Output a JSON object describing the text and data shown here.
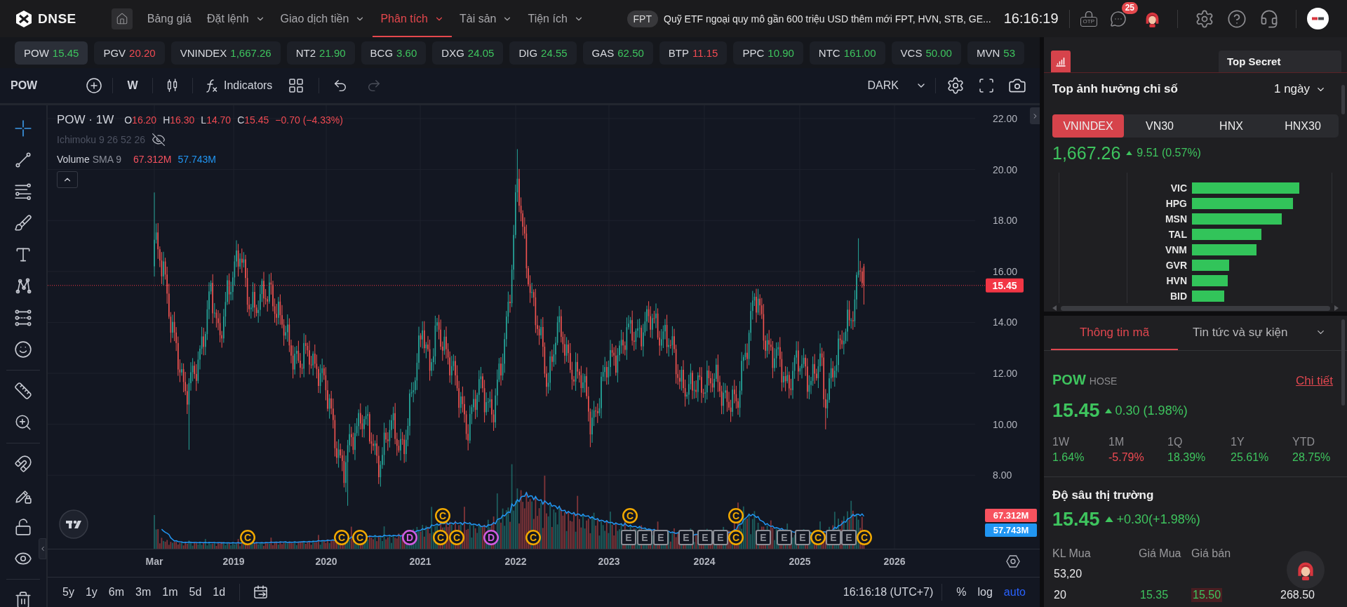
{
  "top_nav": {
    "logo": "DNSE",
    "menu": [
      {
        "label": "Bảng giá",
        "has_menu": false,
        "selected": false
      },
      {
        "label": "Đặt lệnh",
        "has_menu": true,
        "selected": false
      },
      {
        "label": "Giao dịch tiền",
        "has_menu": true,
        "selected": false
      },
      {
        "label": "Phân tích",
        "has_menu": true,
        "selected": true
      },
      {
        "label": "Tài sản",
        "has_menu": true,
        "selected": false
      },
      {
        "label": "Tiện ích",
        "has_menu": true,
        "selected": false
      }
    ],
    "news": {
      "tag": "FPT",
      "headline": "Quỹ ETF ngoại quy mô gần 600 triệu USD thêm mới FPT, HVN, STB, GE..."
    },
    "clock": "16:16:19",
    "otp_label": "OTP",
    "chat_badge": "25"
  },
  "watchlist": [
    {
      "symbol": "POW",
      "price": "15.45",
      "rising": true,
      "selected": true
    },
    {
      "symbol": "PGV",
      "price": "20.20",
      "rising": false,
      "selected": false
    },
    {
      "symbol": "VNINDEX",
      "price": "1,667.26",
      "rising": true,
      "selected": false
    },
    {
      "symbol": "NT2",
      "price": "21.90",
      "rising": true,
      "selected": false
    },
    {
      "symbol": "BCG",
      "price": "3.60",
      "rising": true,
      "selected": false
    },
    {
      "symbol": "DXG",
      "price": "24.05",
      "rising": true,
      "selected": false
    },
    {
      "symbol": "DIG",
      "price": "24.55",
      "rising": true,
      "selected": false
    },
    {
      "symbol": "GAS",
      "price": "62.50",
      "rising": true,
      "selected": false
    },
    {
      "symbol": "BTP",
      "price": "11.15",
      "rising": false,
      "selected": false
    },
    {
      "symbol": "PPC",
      "price": "10.90",
      "rising": true,
      "selected": false
    },
    {
      "symbol": "NTC",
      "price": "161.00",
      "rising": true,
      "selected": false
    },
    {
      "symbol": "VCS",
      "price": "50.00",
      "rising": true,
      "selected": false
    },
    {
      "symbol": "MVN",
      "price": "53",
      "rising": true,
      "selected": false
    }
  ],
  "chart_toolbar": {
    "symbol": "POW",
    "interval": "W",
    "indicators": "Indicators",
    "history": [
      {
        "kind": "undo",
        "disabled": false
      },
      {
        "kind": "redo",
        "disabled": true
      }
    ],
    "theme": "DARK"
  },
  "drawing_tools": [
    [
      {
        "kind": "crosshair",
        "selected": true
      },
      {
        "kind": "trend-line",
        "selected": false
      },
      {
        "kind": "fib",
        "selected": false
      },
      {
        "kind": "brush",
        "selected": false
      },
      {
        "kind": "text",
        "selected": false
      },
      {
        "kind": "pattern",
        "selected": false
      },
      {
        "kind": "projection",
        "selected": false
      },
      {
        "kind": "emoji",
        "selected": false
      }
    ],
    [
      {
        "kind": "ruler",
        "selected": false
      },
      {
        "kind": "zoom",
        "selected": false
      }
    ],
    [
      {
        "kind": "magnet",
        "selected": false
      },
      {
        "kind": "draw-lock",
        "selected": false
      },
      {
        "kind": "lock",
        "selected": false
      },
      {
        "kind": "eye",
        "selected": false
      }
    ],
    [
      {
        "kind": "trash",
        "selected": false
      }
    ]
  ],
  "chart": {
    "legend": {
      "title": "POW · 1W",
      "rising": false,
      "ohlc": [
        {
          "key": "O",
          "value": "16.20"
        },
        {
          "key": "H",
          "value": "16.30"
        },
        {
          "key": "L",
          "value": "14.70"
        },
        {
          "key": "C",
          "value": "15.45"
        }
      ],
      "change": "−0.70 (−4.33%)"
    },
    "ichimoku": {
      "label": "Ichimoku 9 26 52 26",
      "visible": false
    },
    "volume": {
      "label": "Volume",
      "params": "SMA 9",
      "values": [
        {
          "text": "67.312M",
          "color": "#f7525f"
        },
        {
          "text": "57.743M",
          "color": "#2196f3"
        }
      ]
    },
    "price_ticks": [
      "22.00",
      "20.00",
      "18.00",
      "16.00",
      "14.00",
      "12.00",
      "10.00",
      "8.00"
    ],
    "last_price": "15.45",
    "volume_badges": [
      {
        "text": "67.312M",
        "color": "#f7525f"
      },
      {
        "text": "57.743M",
        "color": "#2196f3"
      }
    ],
    "time_labels": [
      "Mar",
      "2019",
      "2020",
      "2021",
      "2022",
      "2023",
      "2024",
      "2025",
      "2026"
    ],
    "event_markers": {
      "upper": [
        {
          "label": "C",
          "kind": "circle",
          "color": "#f2a900"
        },
        {
          "label": "C",
          "kind": "circle",
          "color": "#f2a900"
        },
        {
          "label": "C",
          "kind": "circle",
          "color": "#f2a900"
        }
      ],
      "lower": [
        {
          "label": "C",
          "kind": "circle",
          "color": "#f2a900"
        },
        {
          "label": "C",
          "kind": "circle",
          "color": "#f2a900"
        },
        {
          "label": "C",
          "kind": "circle",
          "color": "#f2a900"
        },
        {
          "label": "D",
          "kind": "circle",
          "color": "#d05ce3"
        },
        {
          "label": "C",
          "kind": "circle",
          "color": "#f2a900"
        },
        {
          "label": "C",
          "kind": "circle",
          "color": "#f2a900"
        },
        {
          "label": "D",
          "kind": "circle",
          "color": "#d05ce3"
        },
        {
          "label": "C",
          "kind": "circle",
          "color": "#f2a900"
        },
        {
          "label": "E",
          "kind": "square",
          "color": "#8b8e96"
        },
        {
          "label": "E",
          "kind": "square",
          "color": "#8b8e96"
        },
        {
          "label": "E",
          "kind": "square",
          "color": "#8b8e96"
        },
        {
          "label": "E",
          "kind": "square",
          "color": "#8b8e96"
        },
        {
          "label": "E",
          "kind": "square",
          "color": "#8b8e96"
        },
        {
          "label": "E",
          "kind": "square",
          "color": "#8b8e96"
        },
        {
          "label": "C",
          "kind": "circle",
          "color": "#f2a900"
        },
        {
          "label": "E",
          "kind": "square",
          "color": "#8b8e96"
        },
        {
          "label": "E",
          "kind": "square",
          "color": "#8b8e96"
        },
        {
          "label": "E",
          "kind": "square",
          "color": "#8b8e96"
        },
        {
          "label": "C",
          "kind": "circle",
          "color": "#f2a900"
        },
        {
          "label": "E",
          "kind": "square",
          "color": "#8b8e96"
        },
        {
          "label": "E",
          "kind": "square",
          "color": "#8b8e96"
        },
        {
          "label": "C",
          "kind": "circle",
          "color": "#f2a900"
        }
      ]
    }
  },
  "range_bar": {
    "ranges": [
      {
        "label": "5y",
        "selected": false
      },
      {
        "label": "1y",
        "selected": false
      },
      {
        "label": "6m",
        "selected": false
      },
      {
        "label": "3m",
        "selected": false
      },
      {
        "label": "1m",
        "selected": false
      },
      {
        "label": "5d",
        "selected": false
      },
      {
        "label": "1d",
        "selected": false
      }
    ],
    "time": "16:16:18 (UTC+7)",
    "scales": [
      {
        "label": "%",
        "on": false
      },
      {
        "label": "log",
        "on": false
      },
      {
        "label": "auto",
        "on": true
      }
    ]
  },
  "right_panel": {
    "tooltip": "Top Secret",
    "influence": {
      "title": "Top ảnh hưởng chỉ số",
      "period": "1 ngày",
      "indices": [
        {
          "label": "VNINDEX",
          "selected": true
        },
        {
          "label": "VN30",
          "selected": false
        },
        {
          "label": "HNX",
          "selected": false
        },
        {
          "label": "HNX30",
          "selected": false
        }
      ],
      "value": "1,667.26",
      "change": "9.51 (0.57%)",
      "rising": true,
      "bars": [
        "VIC",
        "HPG",
        "MSN",
        "TAL",
        "VNM",
        "GVR",
        "HVN",
        "BID"
      ]
    },
    "info_tabs": [
      {
        "label": "Thông tin mã",
        "selected": true,
        "has_menu": false
      },
      {
        "label": "Tin tức và sự kiện",
        "selected": false,
        "has_menu": true
      }
    ],
    "stock": {
      "symbol": "POW",
      "exchange": "HOSE",
      "detail_link": "Chi tiết",
      "price": "15.45",
      "change": "0.30 (1.98%)",
      "rising": true,
      "periods": [
        {
          "label": "1W",
          "value": "1.64%",
          "rising": true
        },
        {
          "label": "1M",
          "value": "-5.79%",
          "rising": false
        },
        {
          "label": "1Q",
          "value": "18.39%",
          "rising": true
        },
        {
          "label": "1Y",
          "value": "25.61%",
          "rising": true
        },
        {
          "label": "YTD",
          "value": "28.75%",
          "rising": true
        }
      ]
    },
    "depth": {
      "title": "Độ sâu thị trường",
      "price": "15.45",
      "change": "+0.30(+1.98%)",
      "rising": true,
      "columns": [
        "KL Mua",
        "Giá Mua",
        "Giá bán"
      ],
      "rows": [
        [
          "53,20"
        ],
        [
          "20",
          "15.35",
          "15.50",
          "268.50"
        ]
      ]
    }
  }
}
